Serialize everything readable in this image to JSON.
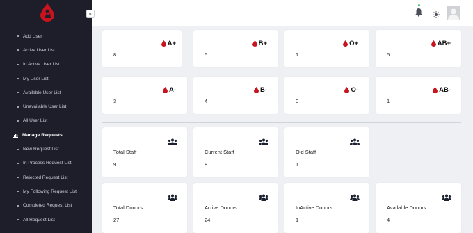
{
  "sidebar": {
    "items": [
      {
        "label": "Add User",
        "type": "sub"
      },
      {
        "label": "Active User List",
        "type": "sub"
      },
      {
        "label": "In Active User List",
        "type": "sub"
      },
      {
        "label": "My User List",
        "type": "sub"
      },
      {
        "label": "Available User List",
        "type": "sub"
      },
      {
        "label": "Unavailable User List",
        "type": "sub"
      },
      {
        "label": "All User List",
        "type": "sub"
      },
      {
        "label": "Manage Requests",
        "type": "section"
      },
      {
        "label": "New Request List",
        "type": "sub"
      },
      {
        "label": "In Process Request List",
        "type": "sub"
      },
      {
        "label": "Rejected Request List",
        "type": "sub"
      },
      {
        "label": "My Following Request List",
        "type": "sub"
      },
      {
        "label": "Completed Request List",
        "type": "sub"
      },
      {
        "label": "All Request List",
        "type": "sub"
      }
    ],
    "collapse_symbol": "«"
  },
  "blood_groups": [
    {
      "type": "A+",
      "count": "8"
    },
    {
      "type": "B+",
      "count": "5"
    },
    {
      "type": "O+",
      "count": "1"
    },
    {
      "type": "AB+",
      "count": "5"
    },
    {
      "type": "A-",
      "count": "3"
    },
    {
      "type": "B-",
      "count": "4"
    },
    {
      "type": "O-",
      "count": "0"
    },
    {
      "type": "AB-",
      "count": "1"
    }
  ],
  "staff_stats": [
    {
      "label": "Total Staff",
      "value": "9"
    },
    {
      "label": "Current Staff",
      "value": "8"
    },
    {
      "label": "Old Staff",
      "value": "1"
    }
  ],
  "donor_stats": [
    {
      "label": "Total Donors",
      "value": "27"
    },
    {
      "label": "Active Donors",
      "value": "24"
    },
    {
      "label": "InActive Donors",
      "value": "1"
    },
    {
      "label": "Available Donors",
      "value": "4"
    }
  ],
  "icons": {
    "logo": "blood-drop-logo-icon",
    "bell": "bell-icon",
    "theme": "sun-icon",
    "avatar": "user-avatar",
    "blood": "blood-drop-icon",
    "people": "users-group-icon",
    "section": "chart-icon"
  },
  "colors": {
    "sidebar_bg": "#1e1e2a",
    "accent_red": "#c8141e",
    "status_green": "#3cc46a"
  }
}
